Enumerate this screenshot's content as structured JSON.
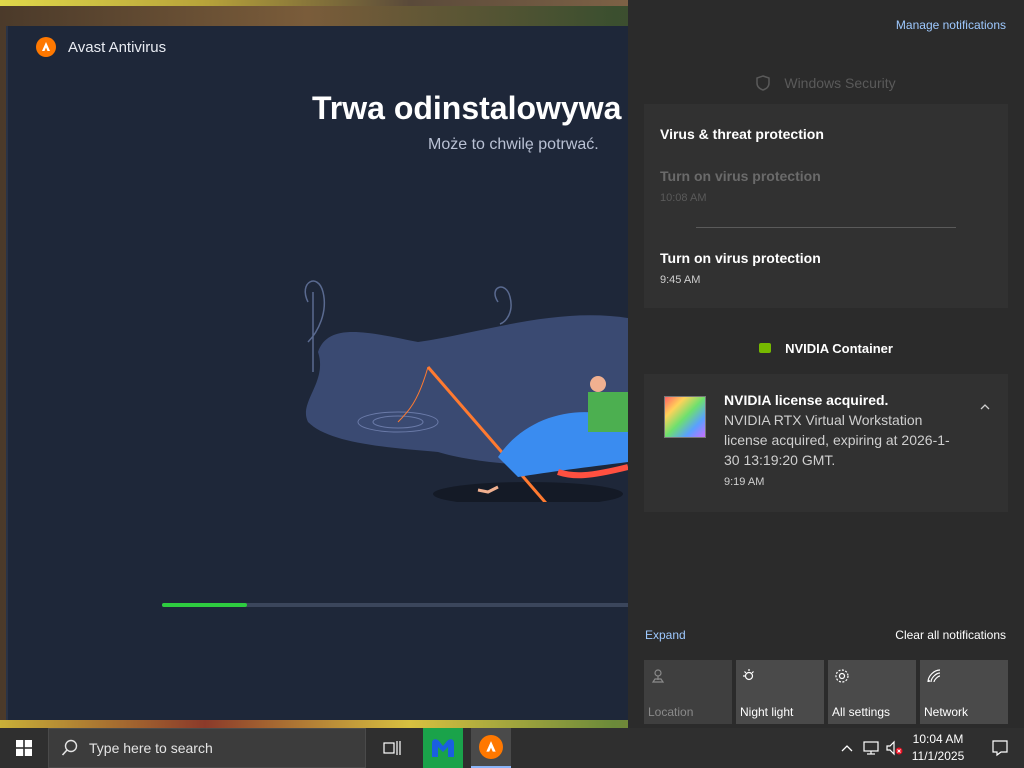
{
  "avast": {
    "title": "Avast Antivirus",
    "heading": "Trwa odinstalowywa",
    "subheading": "Może to chwilę potrwać.",
    "progress_fraction": 0.18,
    "brand_color": "#ff7800"
  },
  "action_center": {
    "manage_label": "Manage notifications",
    "windows_security": {
      "app_name": "Windows Security",
      "group_title": "Virus & threat protection",
      "older": {
        "title": "Turn on virus protection",
        "time": "10:08 AM"
      },
      "latest": {
        "title": "Turn on virus protection",
        "time": "9:45 AM"
      }
    },
    "nvidia": {
      "app_name": "NVIDIA Container",
      "title": "NVIDIA license acquired.",
      "body": "NVIDIA RTX Virtual Workstation license acquired, expiring at 2026-1-30 13:19:20 GMT.",
      "time": "9:19 AM"
    },
    "expand_label": "Expand",
    "clear_label": "Clear all notifications",
    "quick_actions": [
      {
        "label": "Location",
        "icon": "location-icon",
        "enabled": false
      },
      {
        "label": "Night light",
        "icon": "night-light-icon",
        "enabled": true
      },
      {
        "label": "All settings",
        "icon": "gear-icon",
        "enabled": true
      },
      {
        "label": "Network",
        "icon": "network-icon",
        "enabled": true
      }
    ]
  },
  "taskbar": {
    "search_placeholder": "Type here to search",
    "time": "10:04 AM",
    "date": "11/1/2025"
  }
}
